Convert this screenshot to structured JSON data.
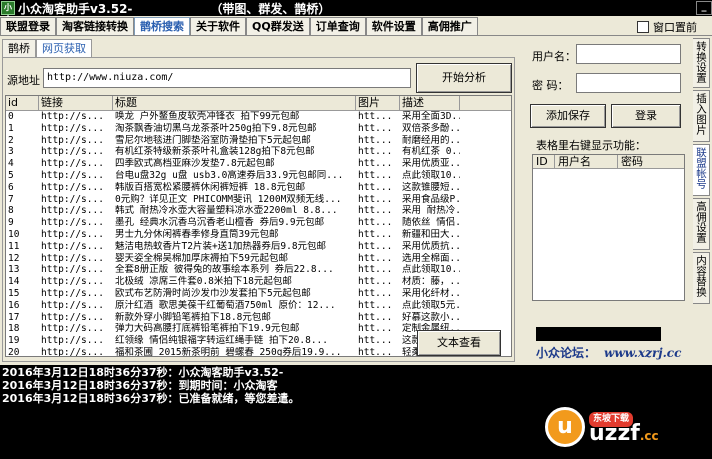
{
  "window": {
    "title": "小众淘客助手v3.52-",
    "subtitle": "（带图、群发、鹊桥）",
    "app_icon": "小众",
    "minimize": "_"
  },
  "main_tabs": [
    "联盟登录",
    "淘客链接转换",
    "鹊桥搜索",
    "关于软件",
    "QQ群发送",
    "订单查询",
    "软件设置",
    "高佣推广"
  ],
  "top_option": {
    "label": "窗口置前",
    "checked": false
  },
  "sub_tabs": [
    "鹊桥",
    "网页获取"
  ],
  "url_bar": {
    "label": "源地址",
    "value": "http://www.niuza.com/"
  },
  "analyze_button": "开始分析",
  "table": {
    "headers": [
      "id",
      "链接",
      "标题",
      "图片",
      "描述"
    ],
    "rows": [
      [
        "0",
        "http://s...",
        "唤龙 户外鳌鱼皮软壳冲锋衣 拍下99元包邮",
        "htt...",
        "采用全面3D..."
      ],
      [
        "1",
        "http://s...",
        "淘茶飘香油切黑乌龙茶茶叶250g拍下9.8元包邮",
        "htt...",
        "双倍茶多酚..."
      ],
      [
        "2",
        "http://s...",
        "雪尼尔地毯进门脚垫浴室防滑垫拍下5元起包邮",
        "htt...",
        "耐磨经用的..."
      ],
      [
        "3",
        "http://s...",
        "有机红茶特级新茶茶叶礼盒装128g拍下8元包邮",
        "htt...",
        "有机红茶 0..."
      ],
      [
        "4",
        "http://s...",
        "四季欧式高档亚麻沙发垫7.8元起包邮",
        "htt...",
        "采用优质亚..."
      ],
      [
        "5",
        "http://s...",
        "台电u盘32g u盘 usb3.0高速券后33.9元包邮同...",
        "htt...",
        "点此领取10..."
      ],
      [
        "6",
        "http://s...",
        "韩版百搭宽松紧腰裤休闲裤短裤 18.8元包邮",
        "htt...",
        "这款锥腰短..."
      ],
      [
        "7",
        "http://s...",
        "0元购？详见正文 PHICOMM斐讯 1200M双频无线...",
        "htt...",
        "采用食品级P..."
      ],
      [
        "8",
        "http://s...",
        "韩式 耐热冷水壶大容量塑料凉水壶2200ml 8.8...",
        "htt...",
        "采用 耐热冷..."
      ],
      [
        "9",
        "http://s...",
        "墨孔 经典水沉香乌沉香老山檀香 券后9.9元包邮",
        "htt...",
        "随依丝 情侣..."
      ],
      [
        "10",
        "http://s...",
        "男士九分休闲裤春季修身直筒39元包邮",
        "htt...",
        "新疆和田大..."
      ],
      [
        "11",
        "http://s...",
        "魅洁电热蚊香片T2片装+送1加热器券后9.8元包邮",
        "htt...",
        "采用优质抗..."
      ],
      [
        "12",
        "http://s...",
        "婴天姿全棉吴棉加厚床褥拍下59元起包邮",
        "htt...",
        "选用全棉面..."
      ],
      [
        "13",
        "http://s...",
        "全套8册正版 彼得兔的故事绘本系列 券后22.8...",
        "htt...",
        "点此领取10..."
      ],
      [
        "14",
        "http://s...",
        "北极绒 凉席三件套0.8米拍下18元起包邮",
        "htt...",
        "材质：藤，..."
      ],
      [
        "15",
        "http://s...",
        "欧式布艺防滑时尚沙发巾沙发套拍下5元起包邮",
        "htt...",
        "采用化纤材..."
      ],
      [
        "16",
        "http://s...",
        "原汁红酒 歌思美葆干红葡萄酒750ml 原价：12...",
        "htt...",
        "点此领取5元..."
      ],
      [
        "17",
        "http://s...",
        "新款外穿小脚铅笔裤拍下18.8元包邮",
        "htt...",
        "好慕这款小..."
      ],
      [
        "18",
        "http://s...",
        "弹力大码高腰打底裤铅笔裤拍下19.9元包邮",
        "htt...",
        "定制金属纽..."
      ],
      [
        "19",
        "http://s...",
        "红领缘 情侣纯银福字转运红绳手链 拍下20.8...",
        "htt...",
        "这款时尚的..."
      ],
      [
        "20",
        "http://s...",
        "福和茶圃 2015新茶明前 碧螺春 250g券后19.9...",
        "htt...",
        "轻柔的滴茶..."
      ],
      [
        "21",
        "",
        "",
        "",
        ""
      ]
    ]
  },
  "text_view_button": "文本查看",
  "account": {
    "username_label": "用户名：",
    "username_value": "",
    "password_label": "密  码：",
    "password_value": "",
    "save_button": "添加保存",
    "login_button": "登录",
    "double_click_hint": "表格里右键显示功能：",
    "table_headers": [
      "ID",
      "用户名",
      "密码"
    ],
    "forum_label": "小众论坛：",
    "forum_url": "www.xzrj.cc"
  },
  "side_tabs": [
    "转换设置",
    "插入图片",
    "联盟帐号",
    "高佣设置",
    "内容替换"
  ],
  "log_lines": [
    {
      "time": "2016年3月12日18时36分37秒：",
      "text": "小众淘客助手v3.52-"
    },
    {
      "time": "2016年3月12日18时36分37秒：",
      "text": "到期时间：小众淘客"
    },
    {
      "time": "2016年3月12日18时36分37秒：",
      "text": "已准备就绪，等您差遣。"
    }
  ],
  "watermark": {
    "badge": "东坡下载",
    "main": "uzzf",
    "suffix": ".cc"
  }
}
